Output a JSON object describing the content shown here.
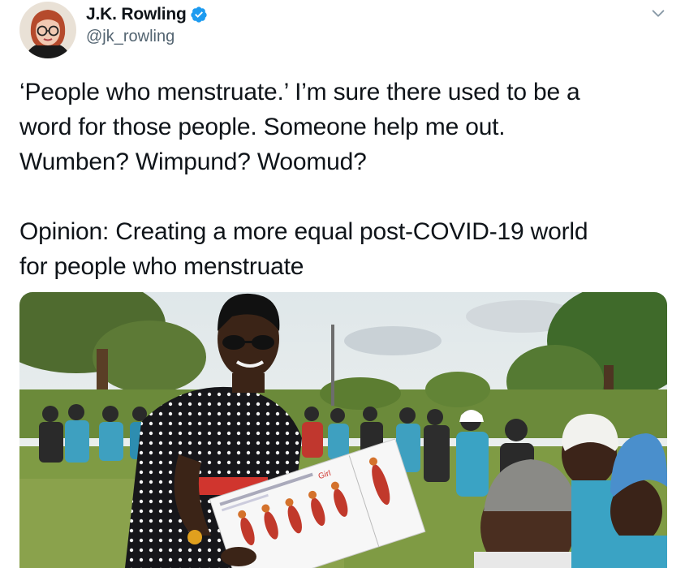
{
  "author": {
    "name": "J.K. Rowling",
    "handle": "@jk_rowling",
    "verified": true,
    "avatar_icon": "profile-photo-icon"
  },
  "menu_icon": "chevron-down-icon",
  "tweet": {
    "text": "‘People who menstruate.’ I’m sure there used to be a\nword for those people. Someone help me out.\nWumben? Wimpund? Woomud?\n\nOpinion: Creating a more equal post-COVID-19 world\nfor people who menstruate"
  },
  "media": {
    "chart_title": "Girl"
  },
  "colors": {
    "verified_blue": "#1d9bf0",
    "secondary_text": "#536471"
  }
}
